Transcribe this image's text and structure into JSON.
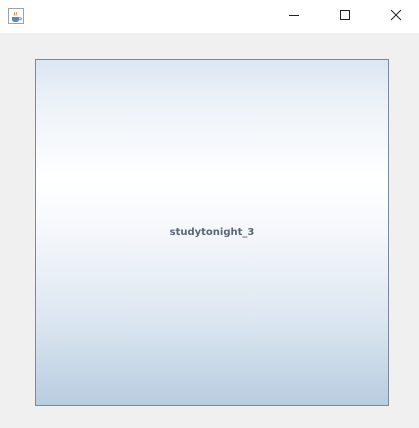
{
  "window": {
    "app_icon": "java-coffee-cup-icon",
    "controls": {
      "minimize_icon": "minimize-icon",
      "maximize_icon": "maximize-icon",
      "close_icon": "close-icon"
    }
  },
  "main": {
    "button_label": "studytonight_3"
  },
  "colors": {
    "titlebar": "#ffffff",
    "background": "#f0f0f0",
    "button_border": "#7a8a9c",
    "button_gradient_top": "#dce7f2",
    "button_gradient_mid": "#ffffff",
    "button_gradient_bottom": "#b8cde0",
    "label_text": "#5c6673"
  }
}
